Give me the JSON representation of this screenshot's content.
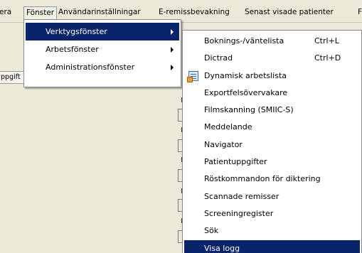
{
  "menubar": {
    "items": [
      "era",
      "Fönster",
      "Användarinställningar",
      "E-remissbevakning",
      "Senast visade patienter",
      "F"
    ]
  },
  "background": {
    "tab_label": "ppgift",
    "mark_glyph": "F"
  },
  "fonster_menu": {
    "items": [
      {
        "label": "Verktygsfönster",
        "has_submenu": true,
        "highlighted": true
      },
      {
        "label": "Arbetsfönster",
        "has_submenu": true
      },
      {
        "label": "Administrationsfönster",
        "has_submenu": true
      }
    ]
  },
  "verktyg_menu": {
    "items": [
      {
        "label": "Boknings-/väntelista",
        "shortcut": "Ctrl+L"
      },
      {
        "label": "Dictrad",
        "shortcut": "Ctrl+D"
      },
      {
        "label": "Dynamisk arbetslista",
        "icon": "worklist-icon"
      },
      {
        "label": "Exportfelsövervakare"
      },
      {
        "label": "Filmskanning (SMIIC-S)"
      },
      {
        "label": "Meddelande"
      },
      {
        "label": "Navigator"
      },
      {
        "label": "Patientuppgifter"
      },
      {
        "label": "Röstkommandon för diktering"
      },
      {
        "label": "Scannade remisser"
      },
      {
        "label": "Screeningregister"
      },
      {
        "label": "Sök"
      },
      {
        "label": "Visa logg",
        "highlighted": true
      }
    ]
  }
}
